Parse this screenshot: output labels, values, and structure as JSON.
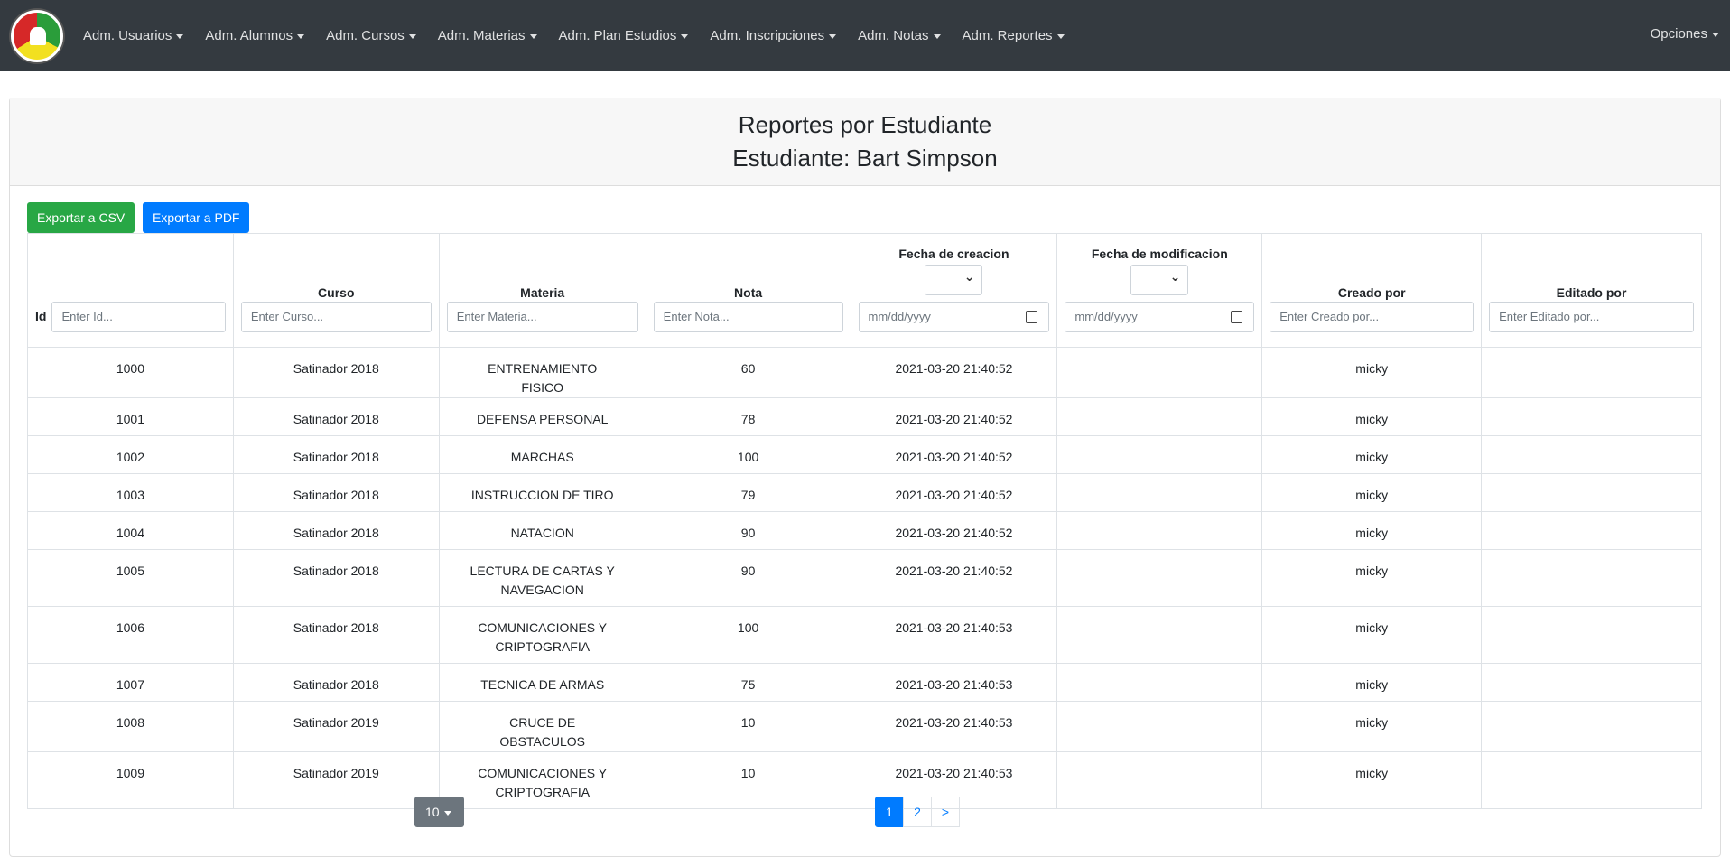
{
  "nav": {
    "items": [
      "Adm. Usuarios",
      "Adm. Alumnos",
      "Adm. Cursos",
      "Adm. Materias",
      "Adm. Plan Estudios",
      "Adm. Inscripciones",
      "Adm. Notas",
      "Adm. Reportes"
    ],
    "options": "Opciones"
  },
  "header": {
    "title": "Reportes por Estudiante",
    "subtitle": "Estudiante: Bart Simpson"
  },
  "buttons": {
    "csv": "Exportar a CSV",
    "pdf": "Exportar a PDF"
  },
  "columns": [
    {
      "label": "Id",
      "placeholder": "Enter Id..."
    },
    {
      "label": "Curso",
      "placeholder": "Enter Curso..."
    },
    {
      "label": "Materia",
      "placeholder": "Enter Materia..."
    },
    {
      "label": "Nota",
      "placeholder": "Enter Nota..."
    },
    {
      "label": "Fecha de creacion",
      "placeholder": "mm/dd/yyyy"
    },
    {
      "label": "Fecha de modificacion",
      "placeholder": "mm/dd/yyyy"
    },
    {
      "label": "Creado por",
      "placeholder": "Enter Creado por..."
    },
    {
      "label": "Editado por",
      "placeholder": "Enter Editado por..."
    }
  ],
  "rows": [
    [
      "1000",
      "Satinador 2018",
      "ENTRENAMIENTO FISICO",
      "60",
      "2021-03-20 21:40:52",
      "",
      "micky",
      ""
    ],
    [
      "1001",
      "Satinador 2018",
      "DEFENSA PERSONAL",
      "78",
      "2021-03-20 21:40:52",
      "",
      "micky",
      ""
    ],
    [
      "1002",
      "Satinador 2018",
      "MARCHAS",
      "100",
      "2021-03-20 21:40:52",
      "",
      "micky",
      ""
    ],
    [
      "1003",
      "Satinador 2018",
      "INSTRUCCION DE TIRO",
      "79",
      "2021-03-20 21:40:52",
      "",
      "micky",
      ""
    ],
    [
      "1004",
      "Satinador 2018",
      "NATACION",
      "90",
      "2021-03-20 21:40:52",
      "",
      "micky",
      ""
    ],
    [
      "1005",
      "Satinador 2018",
      "LECTURA DE CARTAS Y NAVEGACION",
      "90",
      "2021-03-20 21:40:52",
      "",
      "micky",
      ""
    ],
    [
      "1006",
      "Satinador 2018",
      "COMUNICACIONES Y CRIPTOGRAFIA",
      "100",
      "2021-03-20 21:40:53",
      "",
      "micky",
      ""
    ],
    [
      "1007",
      "Satinador 2018",
      "TECNICA DE ARMAS",
      "75",
      "2021-03-20 21:40:53",
      "",
      "micky",
      ""
    ],
    [
      "1008",
      "Satinador 2019",
      "CRUCE DE OBSTACULOS",
      "10",
      "2021-03-20 21:40:53",
      "",
      "micky",
      ""
    ],
    [
      "1009",
      "Satinador 2019",
      "COMUNICACIONES Y CRIPTOGRAFIA",
      "10",
      "2021-03-20 21:40:53",
      "",
      "micky",
      ""
    ]
  ],
  "pagination": {
    "page_size": "10",
    "pages": [
      "1",
      "2",
      ">"
    ],
    "active": "1"
  }
}
